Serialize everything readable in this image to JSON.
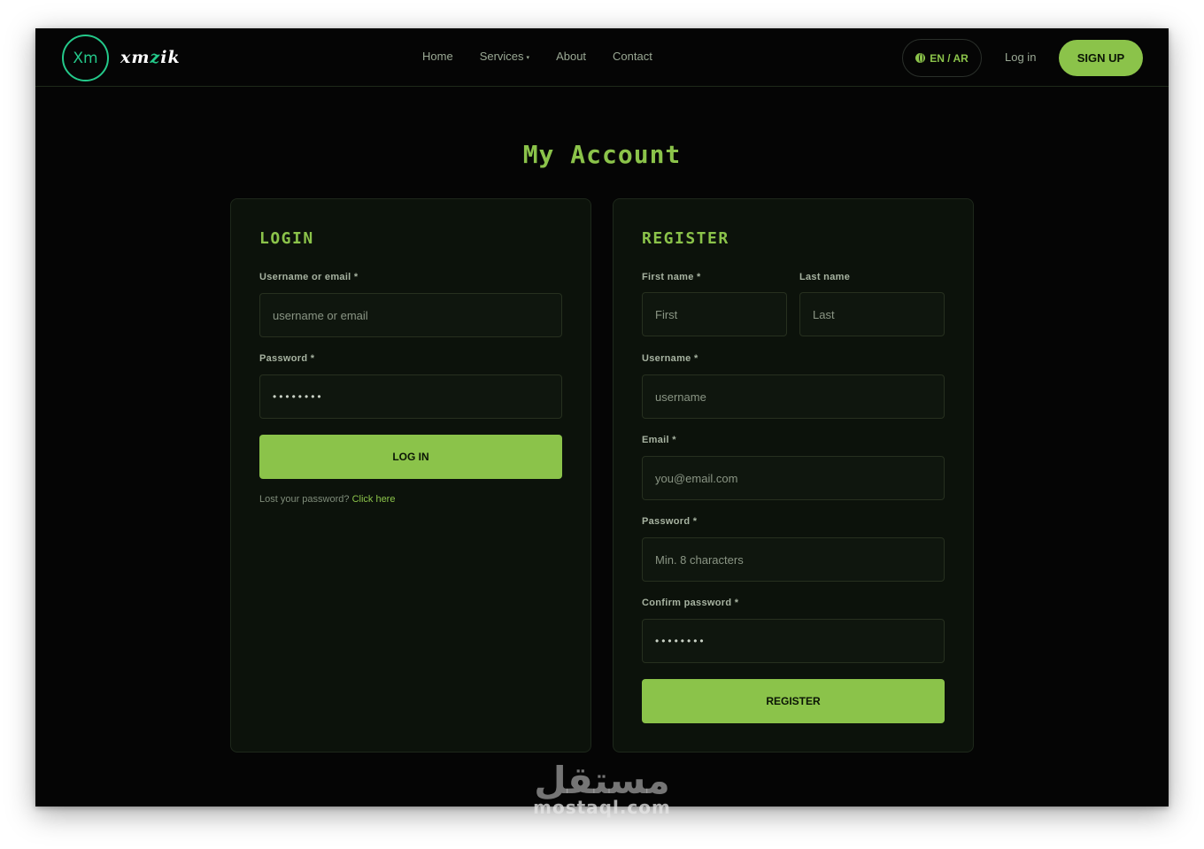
{
  "brand": {
    "logo_mark": "Xm",
    "logo_word_a": "xm",
    "logo_word_b": "z",
    "logo_word_c": "ik"
  },
  "nav": {
    "items": [
      {
        "label": "Home"
      },
      {
        "label": "Services",
        "caret": "▾"
      },
      {
        "label": "About"
      },
      {
        "label": "Contact"
      }
    ],
    "language": "EN / AR",
    "login": "Log in",
    "signup": "SIGN UP"
  },
  "page": {
    "title": "My Account"
  },
  "login": {
    "heading": "LOGIN",
    "username_label": "Username or email *",
    "username_placeholder": "username or email",
    "password_label": "Password *",
    "password_value": "••••••••",
    "submit": "LOG IN",
    "lost_text": "Lost your password?",
    "lost_link": "Click here"
  },
  "register": {
    "heading": "REGISTER",
    "first_label": "First name *",
    "first_placeholder": "First",
    "last_label": "Last name",
    "last_placeholder": "Last",
    "username_label": "Username *",
    "username_placeholder": "username",
    "email_label": "Email *",
    "email_placeholder": "you@email.com",
    "password_label": "Password *",
    "password_placeholder": "Min. 8 characters",
    "confirm_label": "Confirm password *",
    "confirm_value": "••••••••",
    "submit": "REGISTER"
  },
  "watermark": {
    "arabic": "مستقل",
    "latin": "mostaql.com"
  },
  "colors": {
    "accent": "#8bc34a",
    "logo": "#24c98a",
    "background": "#050505",
    "card": "#0c120b"
  },
  "icons": {
    "language": "globe-icon",
    "services_caret": "chevron-down-icon"
  }
}
